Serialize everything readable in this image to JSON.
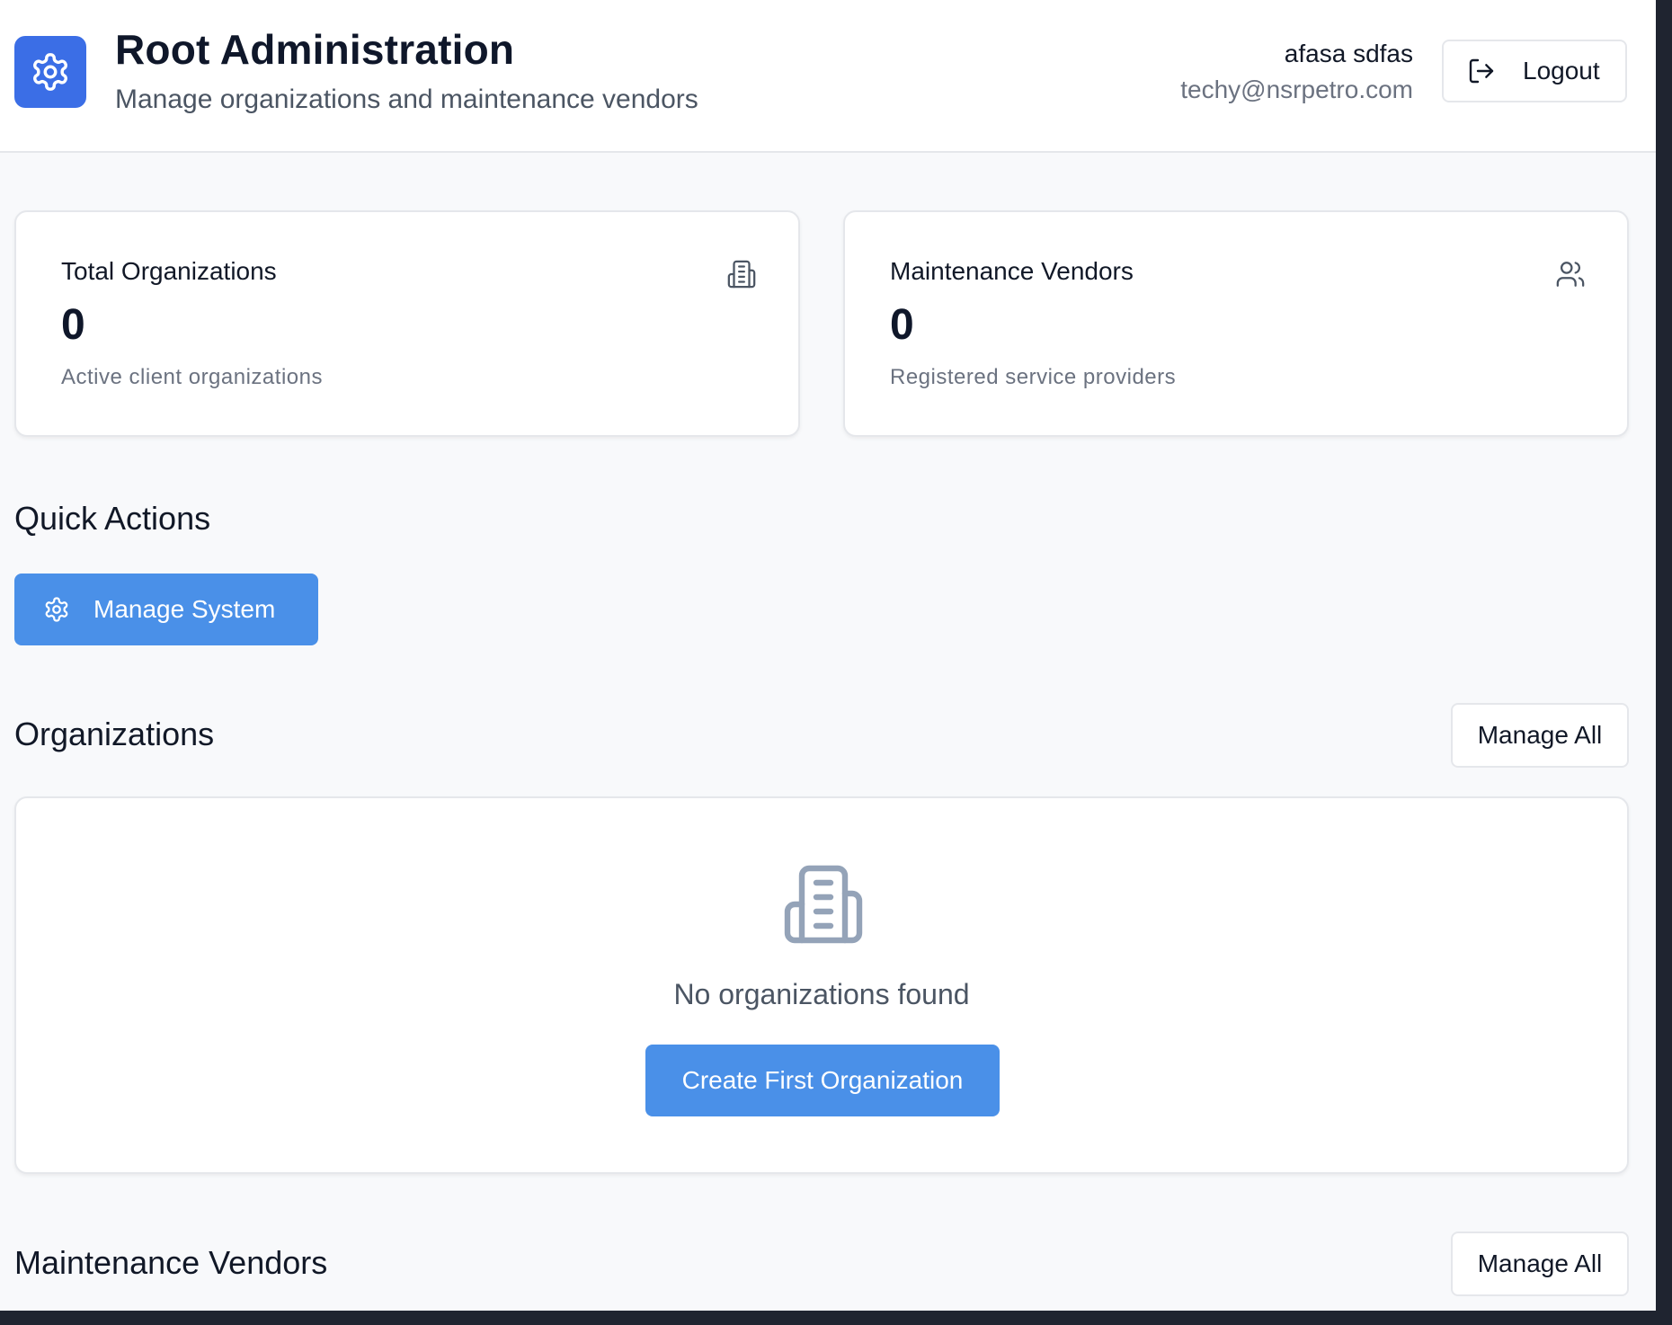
{
  "header": {
    "title": "Root Administration",
    "subtitle": "Manage organizations and maintenance vendors",
    "logo_icon": "gear-icon",
    "user_name": "afasa sdfas",
    "user_email": "techy@nsrpetro.com",
    "logout_label": "Logout",
    "logout_icon": "logout-icon"
  },
  "stats": [
    {
      "title": "Total Organizations",
      "value": "0",
      "description": "Active client organizations",
      "icon": "building-icon"
    },
    {
      "title": "Maintenance Vendors",
      "value": "0",
      "description": "Registered service providers",
      "icon": "users-icon"
    }
  ],
  "quick_actions": {
    "title": "Quick Actions",
    "manage_system_label": "Manage System",
    "manage_system_icon": "gear-icon"
  },
  "organizations": {
    "title": "Organizations",
    "manage_all_label": "Manage All",
    "empty_icon": "building-icon",
    "empty_text": "No organizations found",
    "create_label": "Create First Organization"
  },
  "vendors": {
    "title": "Maintenance Vendors",
    "manage_all_label": "Manage All"
  },
  "colors": {
    "accent": "#3b6ee6",
    "button_blue": "#4a90e8",
    "page_background": "#f8f9fb",
    "muted_text": "#6b7280"
  }
}
